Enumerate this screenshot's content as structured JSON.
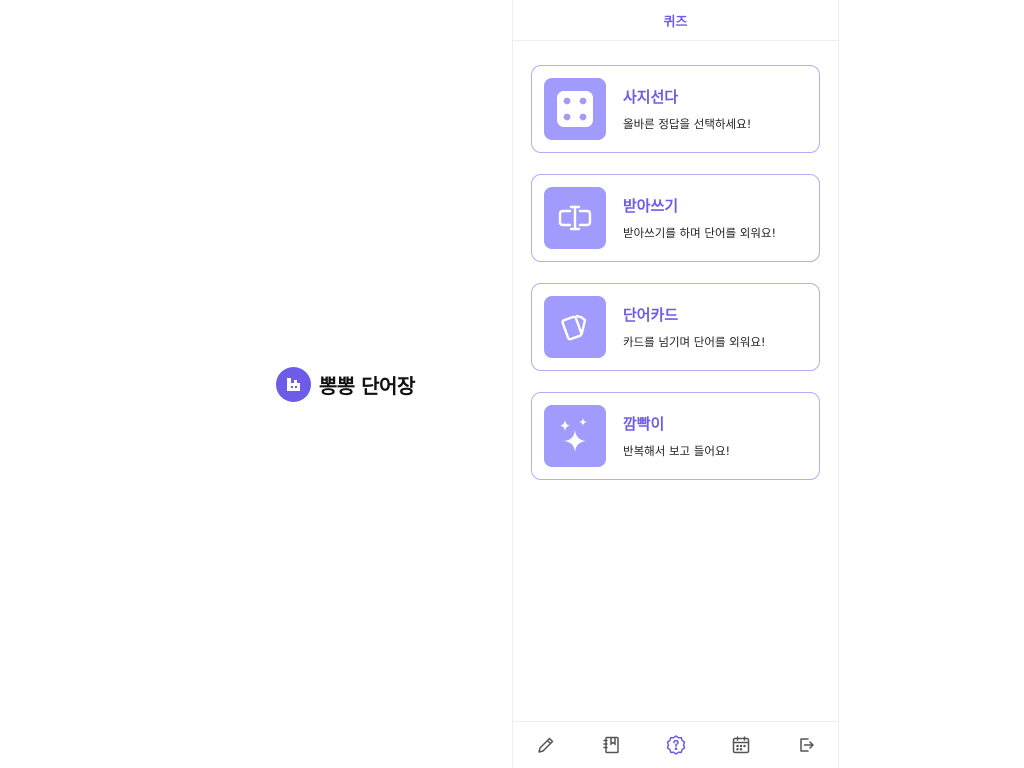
{
  "brand": {
    "name": "뽕뽕 단어장",
    "logo_icon": "building-icon",
    "logo_color": "#6c5ce7"
  },
  "header": {
    "title": "퀴즈"
  },
  "quizzes": [
    {
      "title": "사지선다",
      "desc": "올바른 정답을 선택하세요!",
      "icon": "dice-icon"
    },
    {
      "title": "받아쓰기",
      "desc": "받아쓰기를 하며 단어를 외워요!",
      "icon": "text-cursor-icon"
    },
    {
      "title": "단어카드",
      "desc": "카드를 넘기며 단어를 외워요!",
      "icon": "cards-icon"
    },
    {
      "title": "깜빡이",
      "desc": "반복해서 보고 들어요!",
      "icon": "sparkles-icon"
    }
  ],
  "tabs": [
    {
      "icon": "pencil-icon",
      "active": false
    },
    {
      "icon": "notebook-icon",
      "active": false
    },
    {
      "icon": "quiz-badge-icon",
      "active": true
    },
    {
      "icon": "calendar-icon",
      "active": false
    },
    {
      "icon": "logout-icon",
      "active": false
    }
  ],
  "colors": {
    "accent": "#6c5ce7",
    "icon_bg": "#a29bfe",
    "card_border": "#b4acf7"
  }
}
